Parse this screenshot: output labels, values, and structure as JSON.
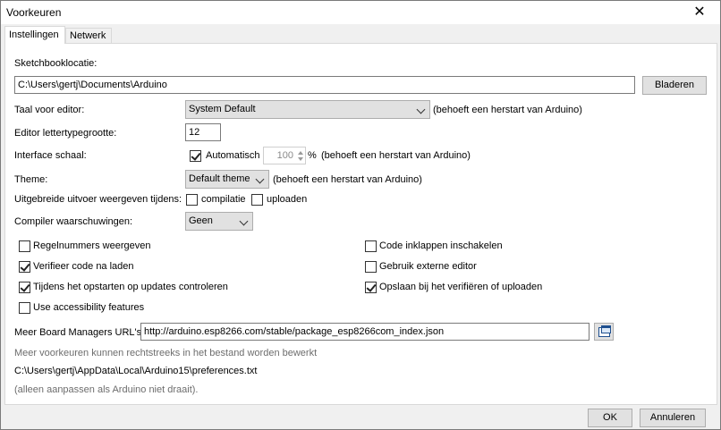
{
  "window": {
    "title": "Voorkeuren",
    "close_glyph": "✕"
  },
  "tabs": [
    {
      "label": "Instellingen"
    },
    {
      "label": "Netwerk"
    }
  ],
  "sketchbook": {
    "label": "Sketchbooklocatie:",
    "value": "C:\\Users\\gertj\\Documents\\Arduino",
    "browse_label": "Bladeren"
  },
  "editor_language": {
    "label": "Taal voor editor:",
    "selected": "System Default",
    "note": "(behoeft een herstart van Arduino)"
  },
  "font_size": {
    "label": "Editor lettertypegrootte:",
    "value": "12"
  },
  "interface_scale": {
    "label": "Interface schaal:",
    "auto_label": "Automatisch",
    "auto_checked": true,
    "value": "100",
    "unit": "%",
    "note": "(behoeft een herstart van Arduino)"
  },
  "theme": {
    "label": "Theme:",
    "selected": "Default theme",
    "note": "(behoeft een herstart van Arduino)"
  },
  "verbose": {
    "label": "Uitgebreide uitvoer weergeven tijdens:",
    "compile_label": "compilatie",
    "compile_checked": false,
    "upload_label": "uploaden",
    "upload_checked": false
  },
  "compiler_warnings": {
    "label": "Compiler waarschuwingen:",
    "selected": "Geen"
  },
  "options_left": [
    {
      "label": "Regelnummers weergeven",
      "checked": false
    },
    {
      "label": "Verifieer code na laden",
      "checked": true
    },
    {
      "label": "Tijdens het opstarten op updates controleren",
      "checked": true
    },
    {
      "label": "Use accessibility features",
      "checked": false
    }
  ],
  "options_right": [
    {
      "label": "Code inklappen inschakelen",
      "checked": false
    },
    {
      "label": "Gebruik externe editor",
      "checked": false
    },
    {
      "label": "Opslaan bij het verifiëren of uploaden",
      "checked": true
    }
  ],
  "board_urls": {
    "label": "Meer Board Managers URL's:",
    "value": "http://arduino.esp8266.com/stable/package_esp8266com_index.json"
  },
  "more_prefs_note": "Meer voorkeuren kunnen rechtstreeks in het bestand worden bewerkt",
  "prefs_path": "C:\\Users\\gertj\\AppData\\Local\\Arduino15\\preferences.txt",
  "prefs_hint": "(alleen aanpassen als Arduino niet draait).",
  "footer": {
    "ok_label": "OK",
    "cancel_label": "Annuleren"
  }
}
